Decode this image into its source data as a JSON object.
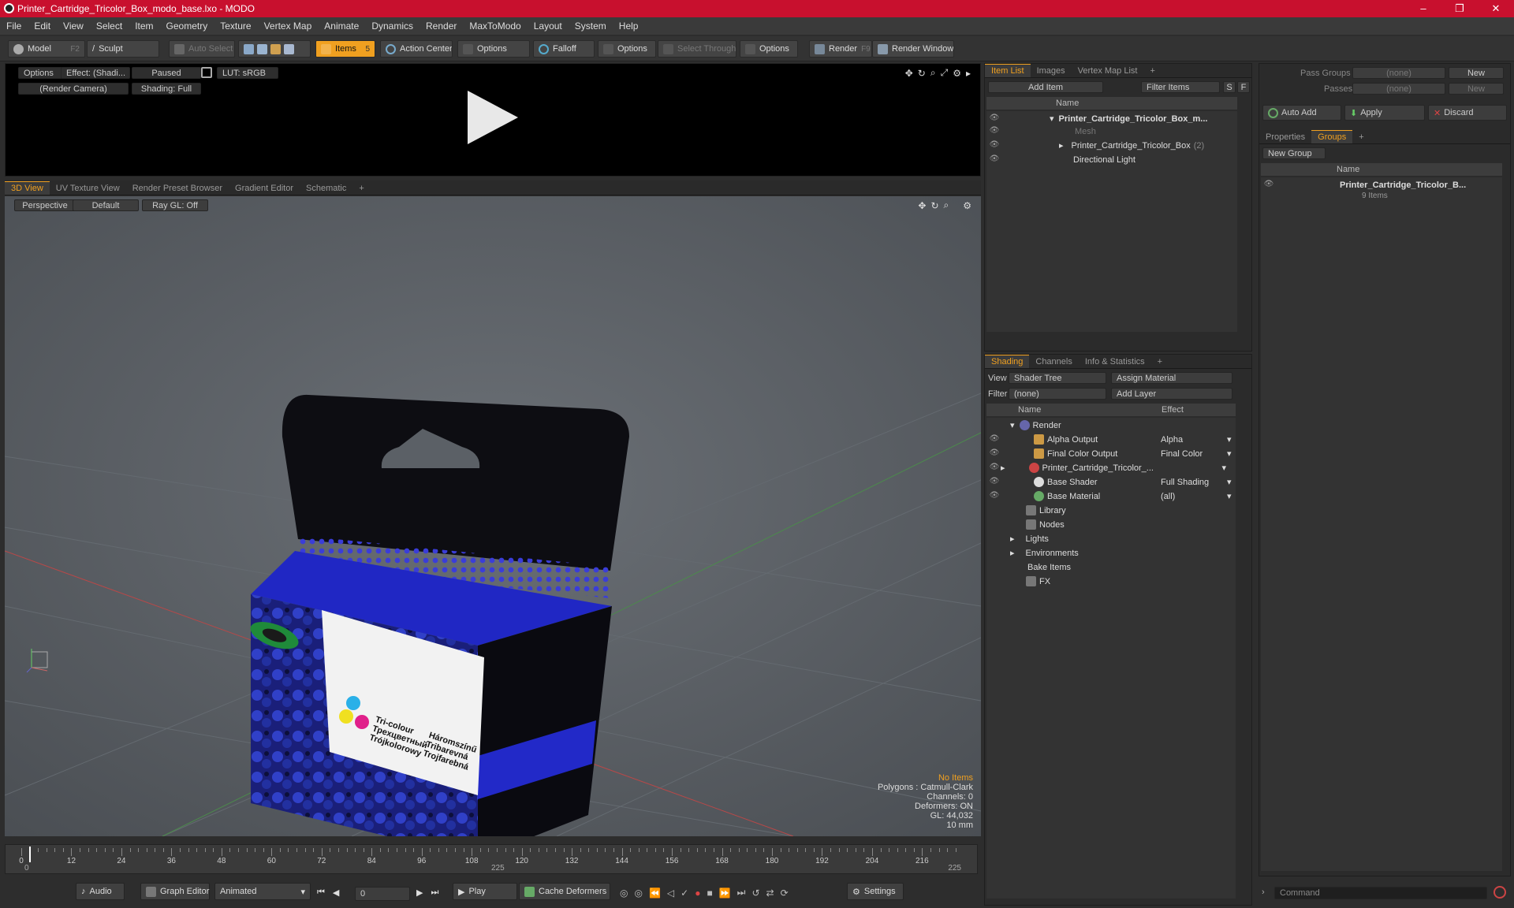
{
  "window": {
    "title": "Printer_Cartridge_Tricolor_Box_modo_base.lxo - MODO",
    "min": "–",
    "max": "❐",
    "close": "✕"
  },
  "menu": [
    "File",
    "Edit",
    "View",
    "Select",
    "Item",
    "Geometry",
    "Texture",
    "Vertex Map",
    "Animate",
    "Dynamics",
    "Render",
    "MaxToModo",
    "Layout",
    "System",
    "Help"
  ],
  "toolbar": {
    "model": "Model",
    "model_key": "F2",
    "sculpt": "Sculpt",
    "auto_select": "Auto Select",
    "items": "Items",
    "items_key": "5",
    "action_center": "Action Center",
    "options1": "Options",
    "falloff": "Falloff",
    "options2": "Options",
    "select_through": "Select Through",
    "options3": "Options",
    "render": "Render",
    "render_key": "F9",
    "render_window": "Render Window"
  },
  "preview": {
    "options": "Options",
    "effect": "Effect: (Shadi...",
    "paused": "Paused",
    "lut": "LUT: sRGB",
    "camera": "(Render Camera)",
    "shading": "Shading: Full"
  },
  "view_tabs": [
    "3D View",
    "UV Texture View",
    "Render Preset Browser",
    "Gradient Editor",
    "Schematic",
    "+"
  ],
  "viewport": {
    "perspective": "Perspective",
    "default": "Default",
    "raygl": "Ray GL: Off",
    "box_texts": {
      "en": "Tri-colour",
      "ru": "Трехцветный",
      "pl": "Trójkolorowy",
      "hu": "Háromszínű",
      "sk": "Tribarevná",
      "cz": "Trojfarebná"
    },
    "stats": {
      "no_items": "No Items",
      "polygons": "Polygons : Catmull-Clark",
      "channels": "Channels: 0",
      "deformers": "Deformers: ON",
      "gl": "GL: 44,032",
      "scale": "10 mm"
    }
  },
  "timeline": {
    "ticks": [
      "0",
      "12",
      "24",
      "36",
      "48",
      "60",
      "72",
      "84",
      "96",
      "108",
      "120",
      "132",
      "144",
      "156",
      "168",
      "180",
      "192",
      "204",
      "216"
    ],
    "start": "0",
    "mid": "225",
    "end": "225"
  },
  "bottom": {
    "audio": "Audio",
    "graph_editor": "Graph Editor",
    "animated": "Animated",
    "frame": "0",
    "play": "Play",
    "cache_deformers": "Cache Deformers",
    "settings": "Settings"
  },
  "item_list": {
    "tabs": [
      "Item List",
      "Images",
      "Vertex Map List",
      "+"
    ],
    "add_item": "Add Item",
    "filter_items": "Filter Items",
    "col_name": "Name",
    "rows": [
      {
        "label": "Printer_Cartridge_Tricolor_Box_m...",
        "bold": true
      },
      {
        "label": "Mesh",
        "dim": true
      },
      {
        "label": "Printer_Cartridge_Tricolor_Box",
        "count": "(2)"
      },
      {
        "label": "Directional Light"
      }
    ]
  },
  "shading": {
    "tabs": [
      "Shading",
      "Channels",
      "Info & Statistics",
      "+"
    ],
    "view_label": "View",
    "view_value": "Shader Tree",
    "assign_material": "Assign Material",
    "filter_label": "Filter",
    "filter_value": "(none)",
    "add_layer": "Add Layer",
    "col_name": "Name",
    "col_effect": "Effect",
    "rows": [
      {
        "label": "Render",
        "effect": ""
      },
      {
        "label": "Alpha Output",
        "effect": "Alpha"
      },
      {
        "label": "Final Color Output",
        "effect": "Final Color"
      },
      {
        "label": "Printer_Cartridge_Tricolor_...",
        "effect": ""
      },
      {
        "label": "Base Shader",
        "effect": "Full Shading"
      },
      {
        "label": "Base Material",
        "effect": "(all)"
      },
      {
        "label": "Library",
        "effect": ""
      },
      {
        "label": "Nodes",
        "effect": ""
      },
      {
        "label": "Lights",
        "effect": ""
      },
      {
        "label": "Environments",
        "effect": ""
      },
      {
        "label": "Bake Items",
        "effect": ""
      },
      {
        "label": "FX",
        "effect": ""
      }
    ]
  },
  "groups": {
    "pass_groups": "Pass Groups",
    "passes": "Passes",
    "none": "(none)",
    "new": "New",
    "auto_add": "Auto Add",
    "apply": "Apply",
    "discard": "Discard",
    "tabs": [
      "Properties",
      "Groups",
      "+"
    ],
    "new_group": "New Group",
    "col_name": "Name",
    "group_name": "Printer_Cartridge_Tricolor_B...",
    "group_items": "9 Items"
  },
  "command": {
    "placeholder": "Command"
  }
}
